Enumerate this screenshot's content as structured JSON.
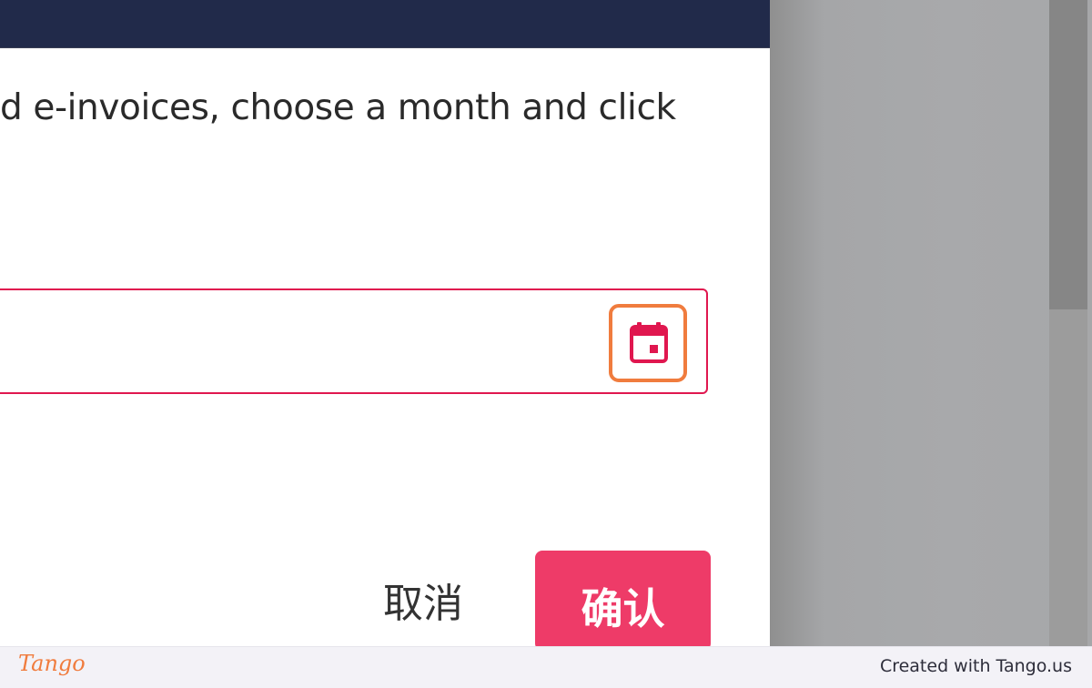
{
  "dialog": {
    "instruction_text": "d e-invoices, choose a month and click",
    "month_input": {
      "value": "",
      "placeholder": ""
    },
    "calendar_icon": "calendar-icon",
    "cancel_label": "取消",
    "confirm_label": "确认"
  },
  "footer": {
    "logo_text": "Tango",
    "credit_text": "Created with Tango.us"
  },
  "colors": {
    "header": "#212a4a",
    "accent": "#e0174f",
    "confirm": "#ee3b68",
    "highlight": "#f07c3e"
  }
}
